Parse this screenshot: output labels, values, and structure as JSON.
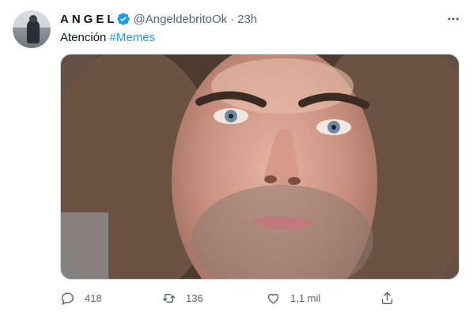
{
  "author": {
    "name": "ANGEL",
    "handle": "@AngeldebritoOk",
    "separator": "·",
    "time": "23h",
    "verified": true
  },
  "tweet": {
    "text": "Atención",
    "hashtag": "#Memes"
  },
  "media": {
    "type": "photo",
    "subject": "close-up selfie of a man with curly hair"
  },
  "actions": {
    "reply_count": "418",
    "retweet_count": "136",
    "like_count": "1,1 mil"
  },
  "icons": {
    "verified": "verified-badge-icon",
    "more": "more-options-icon",
    "reply": "reply-icon",
    "retweet": "retweet-icon",
    "like": "heart-icon",
    "share": "share-icon"
  },
  "colors": {
    "accent": "#1d9bf0",
    "text": "#0f1419",
    "muted": "#536471",
    "border": "#cfd9de"
  }
}
